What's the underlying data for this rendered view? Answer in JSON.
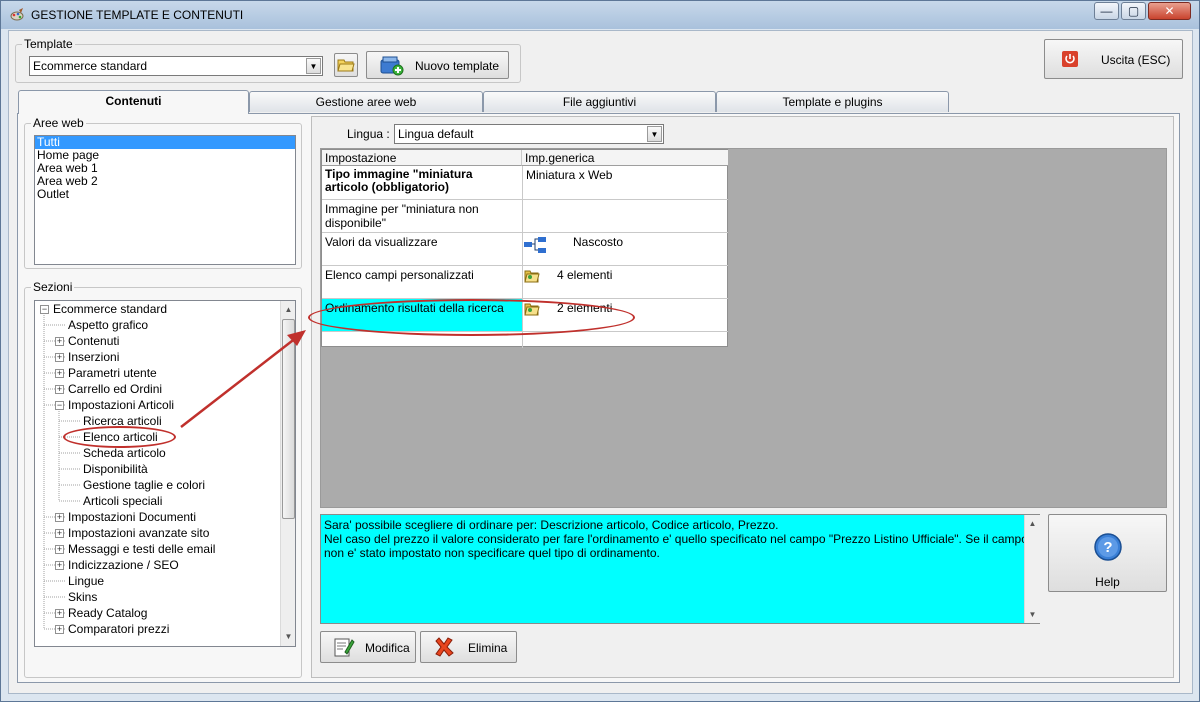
{
  "window": {
    "title": "GESTIONE TEMPLATE E CONTENUTI",
    "min": "—",
    "max": "▢",
    "close": "✕"
  },
  "template_group": {
    "legend": "Template",
    "selected": "Ecommerce standard",
    "new_button": "Nuovo template"
  },
  "exit_button": "Uscita (ESC)",
  "tabs": [
    "Contenuti",
    "Gestione aree web",
    "File aggiuntivi",
    "Template e plugins"
  ],
  "aree_web": {
    "legend": "Aree web",
    "items": [
      "Tutti",
      "Home page",
      "Area web 1",
      "Area web 2",
      "Outlet"
    ]
  },
  "sezioni": {
    "legend": "Sezioni",
    "root": "Ecommerce standard",
    "nodes": [
      {
        "label": "Aspetto grafico",
        "expander": "",
        "level": 1
      },
      {
        "label": "Contenuti",
        "expander": "+",
        "level": 1
      },
      {
        "label": "Inserzioni",
        "expander": "+",
        "level": 1
      },
      {
        "label": "Parametri utente",
        "expander": "+",
        "level": 1
      },
      {
        "label": "Carrello ed Ordini",
        "expander": "+",
        "level": 1
      },
      {
        "label": "Impostazioni Articoli",
        "expander": "−",
        "level": 1
      },
      {
        "label": "Ricerca articoli",
        "expander": "",
        "level": 2
      },
      {
        "label": "Elenco articoli",
        "expander": "",
        "level": 2
      },
      {
        "label": "Scheda articolo",
        "expander": "",
        "level": 2
      },
      {
        "label": "Disponibilità",
        "expander": "",
        "level": 2
      },
      {
        "label": "Gestione taglie e colori",
        "expander": "",
        "level": 2
      },
      {
        "label": "Articoli speciali",
        "expander": "",
        "level": 2
      },
      {
        "label": "Impostazioni Documenti",
        "expander": "+",
        "level": 1
      },
      {
        "label": "Impostazioni avanzate sito",
        "expander": "+",
        "level": 1
      },
      {
        "label": "Messaggi e testi delle email",
        "expander": "+",
        "level": 1
      },
      {
        "label": "Indicizzazione / SEO",
        "expander": "+",
        "level": 1
      },
      {
        "label": "Lingue",
        "expander": "",
        "level": 1
      },
      {
        "label": "Skins",
        "expander": "",
        "level": 1
      },
      {
        "label": "Ready Catalog",
        "expander": "+",
        "level": 1
      },
      {
        "label": "Comparatori prezzi",
        "expander": "+",
        "level": 1
      }
    ]
  },
  "lingua": {
    "label": "Lingua :",
    "selected": "Lingua default"
  },
  "settings_grid": {
    "headers": [
      "Impostazione",
      "Imp.generica"
    ],
    "rows": [
      {
        "setting": "Tipo immagine \"miniatura articolo (obbligatorio)",
        "value": "Miniatura x Web",
        "icon": ""
      },
      {
        "setting": "Immagine per \"miniatura non disponibile\"",
        "value": "",
        "icon": ""
      },
      {
        "setting": "Valori da visualizzare",
        "value": "Nascosto",
        "icon": "hierarchy-icon"
      },
      {
        "setting": "Elenco campi personalizzati",
        "value": "4 elementi",
        "icon": "folder-icon"
      },
      {
        "setting": "Ordinamento risultati della ricerca",
        "value": "2 elementi",
        "icon": "folder-icon"
      }
    ]
  },
  "description": {
    "line1": "Sara' possibile scegliere di ordinare per: Descrizione articolo, Codice articolo, Prezzo.",
    "line2": "Nel caso del prezzo il valore considerato per fare l'ordinamento e' quello specificato nel campo \"Prezzo Listino Ufficiale\". Se il campo non e' stato impostato non specificare quel tipo di ordinamento."
  },
  "help_button": "Help",
  "edit_button": "Modifica",
  "delete_button": "Elimina",
  "colors": {
    "selection": "#3399ff",
    "highlight": "#00ffff",
    "annotation": "#c0302c",
    "grid_bg": "#ababab"
  }
}
